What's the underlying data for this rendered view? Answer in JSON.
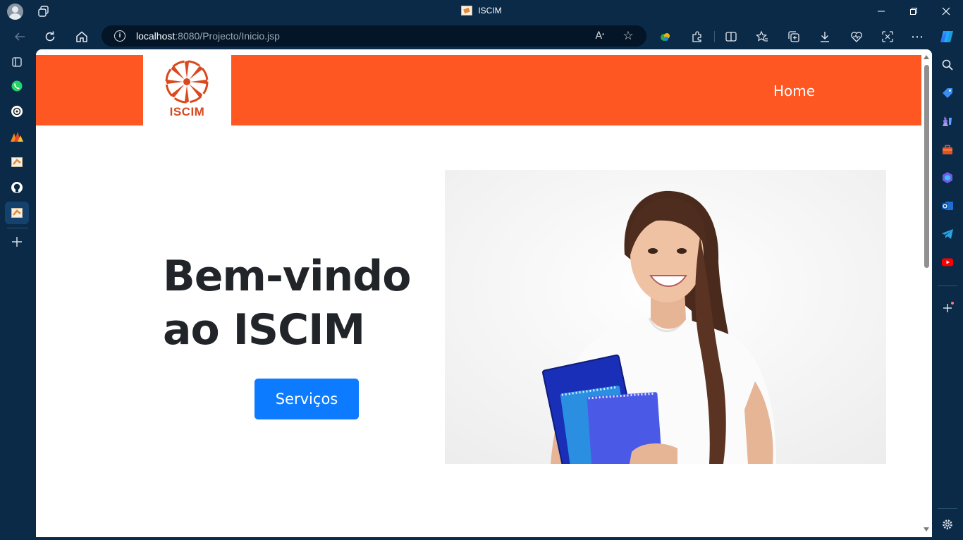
{
  "browser": {
    "tab_title": "ISCIM",
    "url_host": "localhost",
    "url_rest": ":8080/Projecto/Inicio.jsp",
    "window_controls": [
      "minimize",
      "restore",
      "close"
    ]
  },
  "site": {
    "logo_text": "ISCIM",
    "nav": {
      "home": "Home"
    },
    "hero": {
      "title_line1": "Bem-vindo",
      "title_line2": "ao ISCIM",
      "button_label": "Serviços"
    },
    "colors": {
      "header": "#ff5722",
      "button": "#0d7bff",
      "title": "#212529"
    }
  },
  "left_sidebar": {
    "items": [
      "tabs-icon",
      "whatsapp-icon",
      "chatgpt-icon",
      "apps-icon",
      "iscim-tab-icon",
      "github-icon",
      "iscim-active-tab-icon",
      "add-icon"
    ]
  },
  "right_sidebar": {
    "items": [
      "search-icon",
      "shopping-tag-icon",
      "games-icon",
      "tools-icon",
      "copilot-icon",
      "outlook-icon",
      "telegram-icon",
      "youtube-icon",
      "add-icon",
      "settings-icon"
    ]
  }
}
